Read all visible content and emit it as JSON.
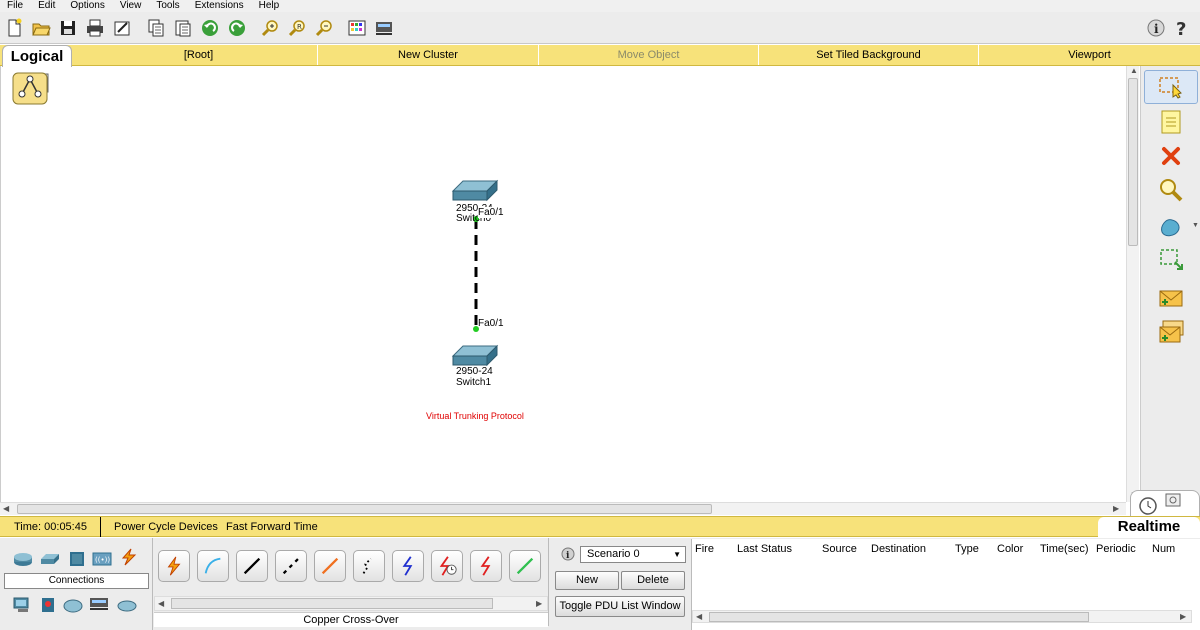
{
  "menu": [
    "File",
    "Edit",
    "Options",
    "View",
    "Tools",
    "Extensions",
    "Help"
  ],
  "tabbar": {
    "logical": "Logical",
    "root": "[Root]",
    "new_cluster": "New Cluster",
    "move_object": "Move Object",
    "set_tiled_background": "Set Tiled Background",
    "viewport": "Viewport"
  },
  "toolbar_icons": [
    "new-file-icon",
    "open-folder-icon",
    "save-icon",
    "print-icon",
    "activity-wizard-icon",
    "copy-icon",
    "paste-icon",
    "undo-icon",
    "redo-icon",
    "zoom-in-icon",
    "zoom-reset-icon",
    "zoom-out-icon",
    "palette-icon",
    "custom-device-icon",
    "info-icon",
    "help-icon"
  ],
  "topology": {
    "devices": [
      {
        "model": "2950-24",
        "name": "Switch0",
        "port": "Fa0/1"
      },
      {
        "model": "2950-24",
        "name": "Switch1",
        "port": "Fa0/1"
      }
    ],
    "note": "Virtual Trunking Protocol",
    "note_color": "#e00000",
    "link_color": "#000000",
    "port_led_color": "#22cc22"
  },
  "status": {
    "time": "Time: 00:05:45",
    "power_cycle": "Power Cycle Devices",
    "fast_forward": "Fast Forward Time",
    "mode": "Realtime"
  },
  "devices_panel": {
    "label": "Connections"
  },
  "cables": {
    "selected": "Copper Cross-Over"
  },
  "scenario": {
    "selected": "Scenario 0",
    "new_label": "New",
    "delete_label": "Delete",
    "toggle_label": "Toggle PDU List Window"
  },
  "pdu_columns": [
    "Fire",
    "Last Status",
    "Source",
    "Destination",
    "Type",
    "Color",
    "Time(sec)",
    "Periodic",
    "Num"
  ],
  "colors": {
    "accent_yellow": "#f7e27a",
    "toolbar_bg": "#ececec"
  }
}
